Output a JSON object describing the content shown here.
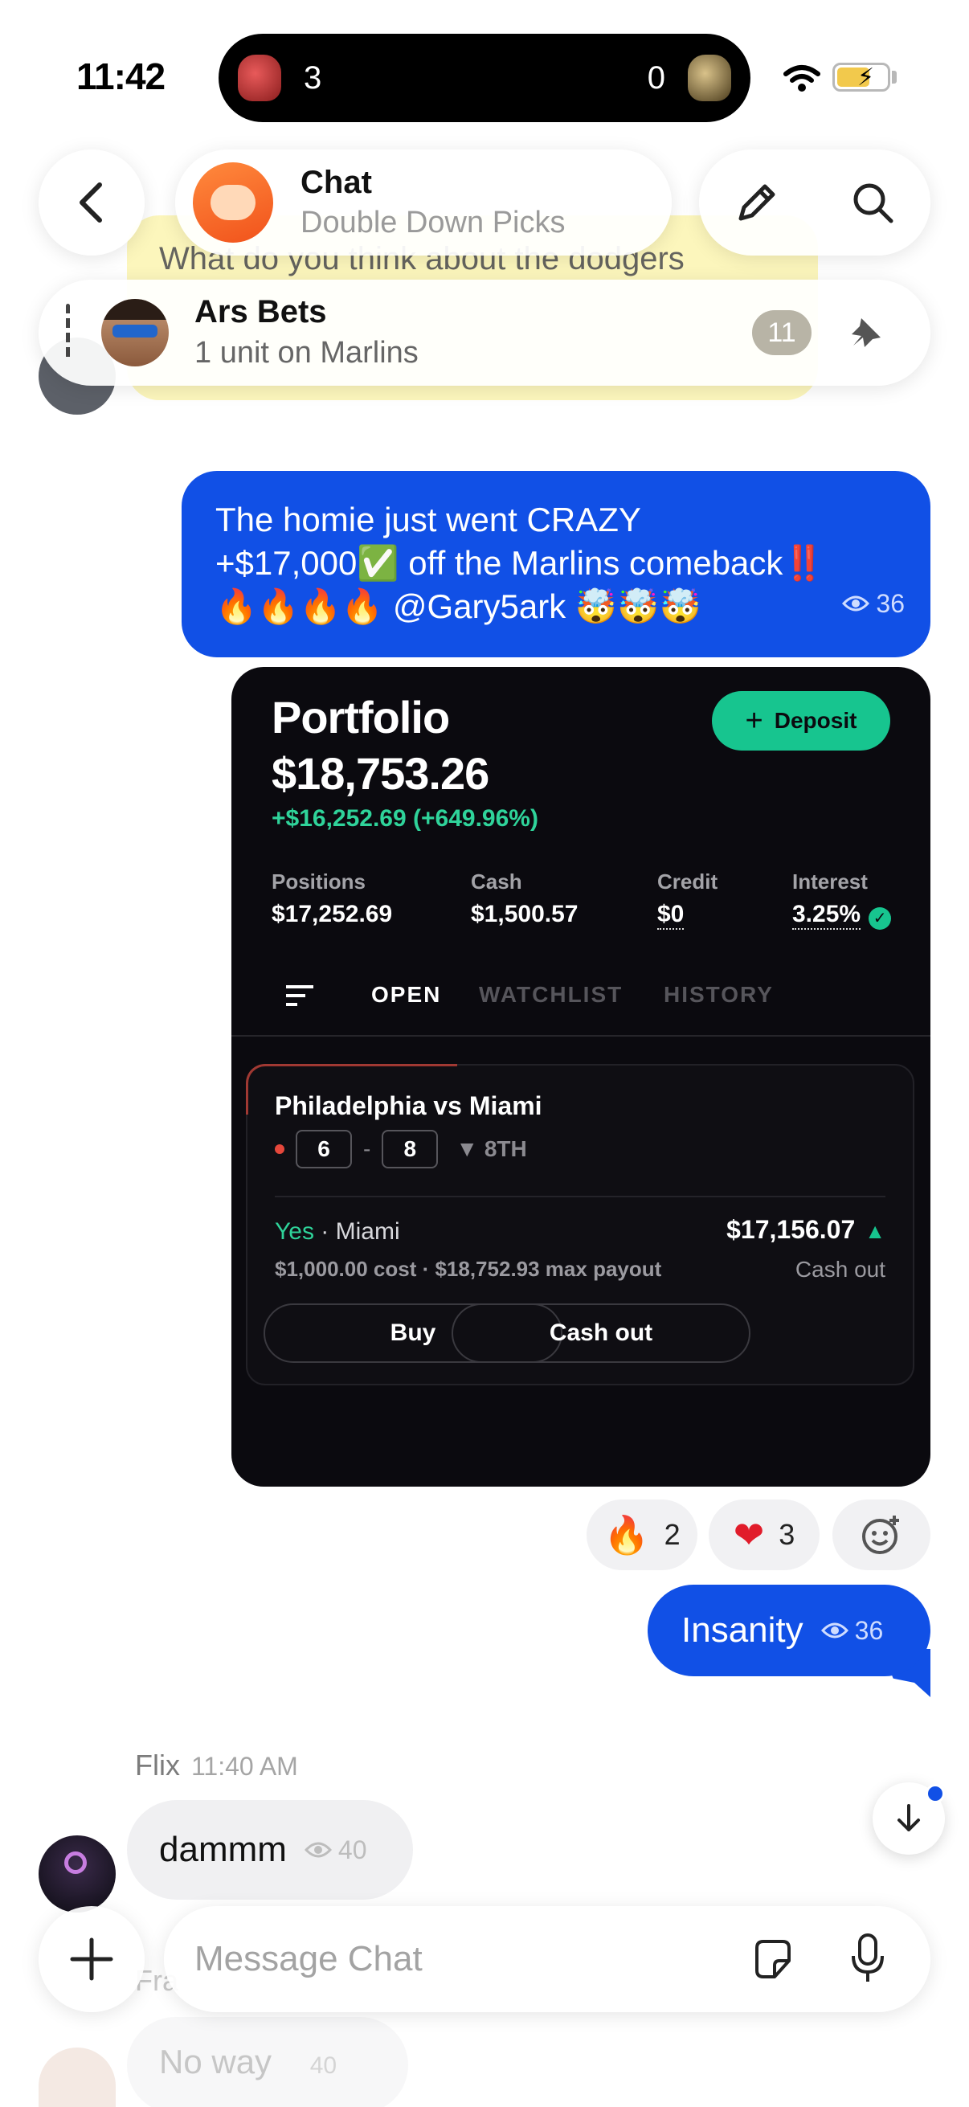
{
  "status_bar": {
    "time": "11:42",
    "live_score": {
      "left_score": "3",
      "right_score": "0"
    }
  },
  "background_ghost": {
    "message_text": "What do you think about the dodgers"
  },
  "header": {
    "title": "Chat",
    "subtitle": "Double Down Picks"
  },
  "pinned": {
    "name": "Ars Bets",
    "text": "1 unit on Marlins",
    "count": "11"
  },
  "messages": {
    "m1": {
      "line1": "The homie just went CRAZY",
      "line2": "+$17,000✅ off the Marlins comeback‼️",
      "line3": "🔥🔥🔥🔥 @Gary5ark 🤯🤯🤯",
      "views": "36"
    },
    "m2": {
      "text": "Insanity",
      "views": "36"
    },
    "m3": {
      "sender": "Flix",
      "time": "11:40 AM",
      "text": "dammm",
      "views": "40"
    },
    "m4_ghost": {
      "sender": "Fra",
      "text": "No way",
      "views": "40"
    }
  },
  "portfolio": {
    "title": "Portfolio",
    "total": "$18,753.26",
    "change": "+$16,252.69 (+649.96%)",
    "deposit_label": "Deposit",
    "stats": [
      {
        "label": "Positions",
        "value": "$17,252.69"
      },
      {
        "label": "Cash",
        "value": "$1,500.57"
      },
      {
        "label": "Credit",
        "value": "$0"
      },
      {
        "label": "Interest",
        "value": "3.25%"
      }
    ],
    "tabs": [
      "OPEN",
      "WATCHLIST",
      "HISTORY"
    ],
    "position": {
      "match": "Philadelphia vs Miami",
      "score_left": "6",
      "score_right": "8",
      "inning": "8TH",
      "pick_yes": "Yes",
      "pick_team": "Miami",
      "cost_line": "$1,000.00 cost · $18,752.93 max payout",
      "value": "$17,156.07",
      "cashout_label": "Cash out",
      "buy_button": "Buy",
      "cashout_button": "Cash out"
    }
  },
  "reactions": [
    {
      "emoji": "fire",
      "count": "2"
    },
    {
      "emoji": "heart",
      "count": "3"
    }
  ],
  "composer": {
    "placeholder": "Message Chat"
  },
  "colors": {
    "outgoing_bubble": "#1150e6",
    "accent_green": "#17c58f",
    "card_bg": "#0b0a0f"
  }
}
